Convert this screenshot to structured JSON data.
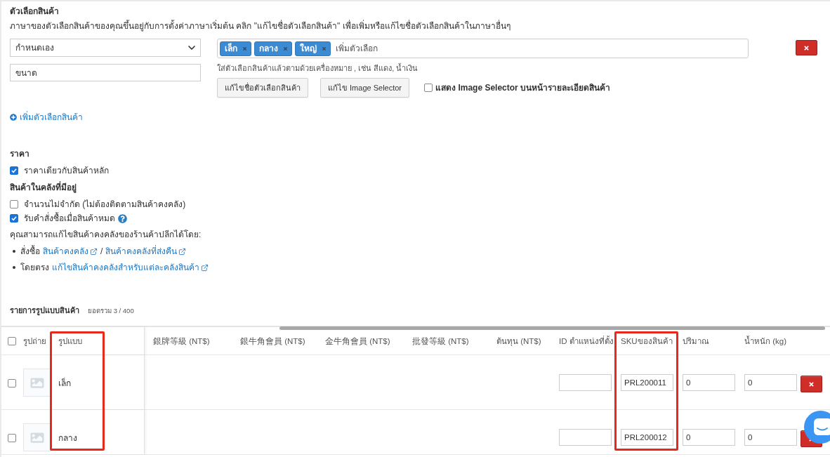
{
  "option_section": {
    "title": "ตัวเลือกสินค้า",
    "description": "ภาษาของตัวเลือกสินค้าของคุณขึ้นอยู่กับการตั้งค่าภาษาเริ่มต้น คลิก \"แก้ไขชื่อตัวเลือกสินค้า\" เพื่อเพิ่มหรือแก้ไขชื่อตัวเลือกสินค้าในภาษาอื่นๆ"
  },
  "option": {
    "type_select": "กำหนดเอง",
    "name_field": "ขนาด",
    "values": [
      "เล็ก",
      "กลาง",
      "ใหญ่"
    ],
    "values_placeholder": "เพิ่มตัวเลือก",
    "hint": "ใส่ตัวเลือกสินค้าแล้วตามด้วยเครื่องหมาย , เช่น สีแดง, น้ำเงิน",
    "buttons": [
      "แก้ไขชื่อตัวเลือกสินค้า",
      "แก้ไข Image Selector"
    ],
    "image_selector_toggle": {
      "label": "แสดง Image Selector บนหน้ารายละเอียดสินค้า",
      "checked": false
    }
  },
  "add_option_link": "เพิ่มตัวเลือกสินค้า",
  "price": {
    "title": "ราคา",
    "checkboxes": [
      {
        "label": "ราคาเดียวกับสินค้าหลัก",
        "checked": true,
        "help": false
      }
    ]
  },
  "inventory": {
    "title": "สินค้าในคลังที่มีอยู่",
    "checkboxes": [
      {
        "label": "จำนวนไม่จำกัด (ไม่ต้องติดตามสินค้าคงคลัง)",
        "checked": false,
        "help": false
      },
      {
        "label": "รับคำสั่งซื้อเมื่อสินค้าหมด",
        "checked": true,
        "help": true
      }
    ],
    "note": "คุณสามารถแก้ไขสินค้าคงคลังของร้านค้าปลีกได้โดย:",
    "methods": [
      [
        {
          "kind": "text",
          "text": "สั่งซื้อ"
        },
        {
          "kind": "link",
          "text": "สินค้าคงคลัง"
        },
        {
          "kind": "text",
          "text": "/"
        },
        {
          "kind": "link",
          "text": "สินค้าคงคลังที่ส่งคืน"
        }
      ],
      [
        {
          "kind": "text",
          "text": "โดยตรง"
        },
        {
          "kind": "link",
          "text": "แก้ไขสินค้าคงคลังสำหรับแต่ละคลังสินค้า"
        }
      ]
    ]
  },
  "variants": {
    "title": "รายการรูปแบบสินค้า",
    "total": "ยอดรวม 3 / 400",
    "select_all": {
      "checked": false
    },
    "columns": [
      {
        "label": "รูปถ่าย",
        "kind": "photo",
        "highlighted": false
      },
      {
        "label": "รูปแบบ",
        "kind": "name",
        "highlighted": true
      },
      {
        "label": "銀牌等級 (NT$)",
        "kind": "price",
        "highlighted": false
      },
      {
        "label": "銀牛角會員 (NT$)",
        "kind": "price",
        "highlighted": false
      },
      {
        "label": "金牛角會員 (NT$)",
        "kind": "price",
        "highlighted": false
      },
      {
        "label": "批發等級 (NT$)",
        "kind": "price",
        "highlighted": false
      },
      {
        "label": "ต้นทุน (NT$)",
        "kind": "price",
        "highlighted": false
      },
      {
        "label": "ID ตำแหน่งที่ตั้ง",
        "kind": "location",
        "highlighted": false
      },
      {
        "label": "SKUของสินค้า",
        "kind": "sku",
        "highlighted": true
      },
      {
        "label": "ปริมาณ",
        "kind": "quantity",
        "highlighted": false
      },
      {
        "label": "น้ำหนัก (kg)",
        "kind": "weight",
        "highlighted": false
      }
    ],
    "rows": [
      {
        "checked": false,
        "name": "เล็ก",
        "sku": "PRL200011",
        "quantity": "0",
        "weight": "0"
      },
      {
        "checked": false,
        "name": "กลาง",
        "sku": "PRL200012",
        "quantity": "0",
        "weight": "0"
      }
    ]
  }
}
